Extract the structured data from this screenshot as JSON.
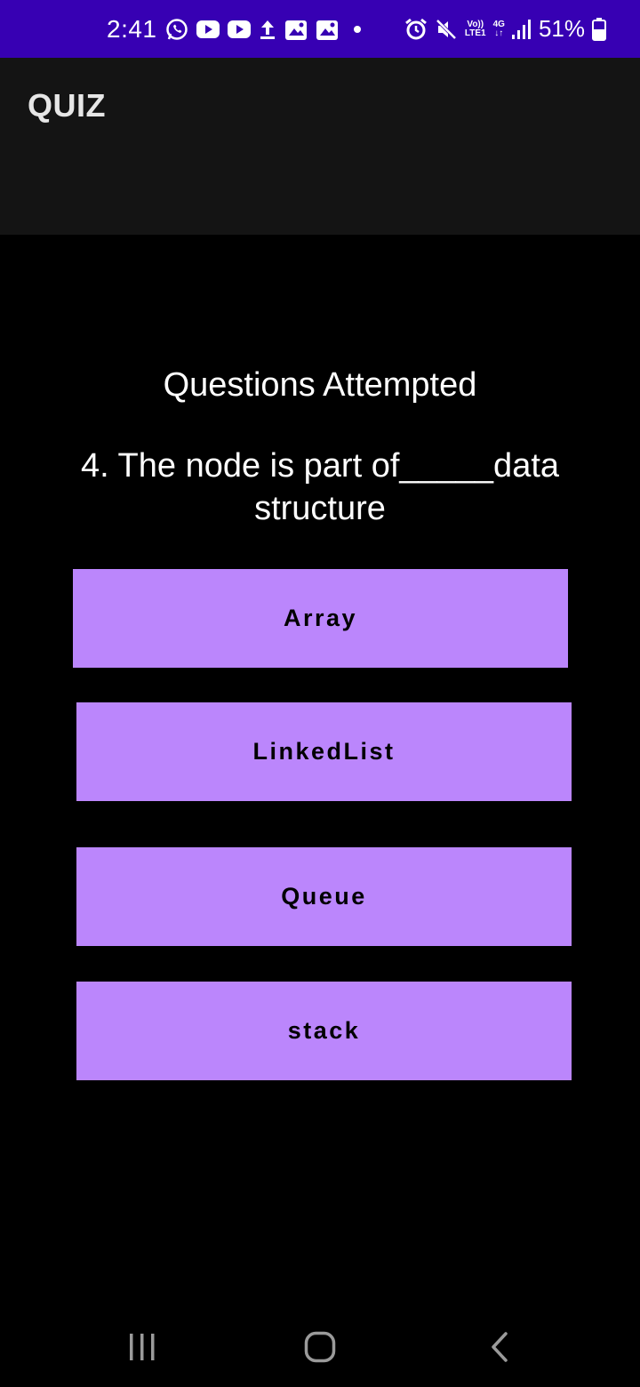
{
  "status_bar": {
    "time": "2:41",
    "battery": "51%",
    "network_top": "Vo))",
    "network_bottom": "LTE1",
    "network_type": "4G",
    "icons": [
      "whatsapp-icon",
      "youtube-icon",
      "youtube-icon",
      "upload-icon",
      "photo-icon",
      "photo-icon",
      "dot-icon",
      "alarm-icon",
      "mute-icon",
      "signal-icon",
      "battery-icon"
    ]
  },
  "app_bar": {
    "title": "QUIZ"
  },
  "quiz": {
    "attempted_label": "Questions Attempted",
    "question": "4. The node is part of_____data structure",
    "options": [
      "Array",
      "LinkedList",
      "Queue",
      "stack"
    ]
  },
  "nav_bar": {
    "icons": [
      "recent-apps-icon",
      "home-icon",
      "back-icon"
    ]
  },
  "colors": {
    "status_bar": "#3700b3",
    "app_bar": "#141414",
    "background": "#000000",
    "option_button": "#bb86fc"
  }
}
